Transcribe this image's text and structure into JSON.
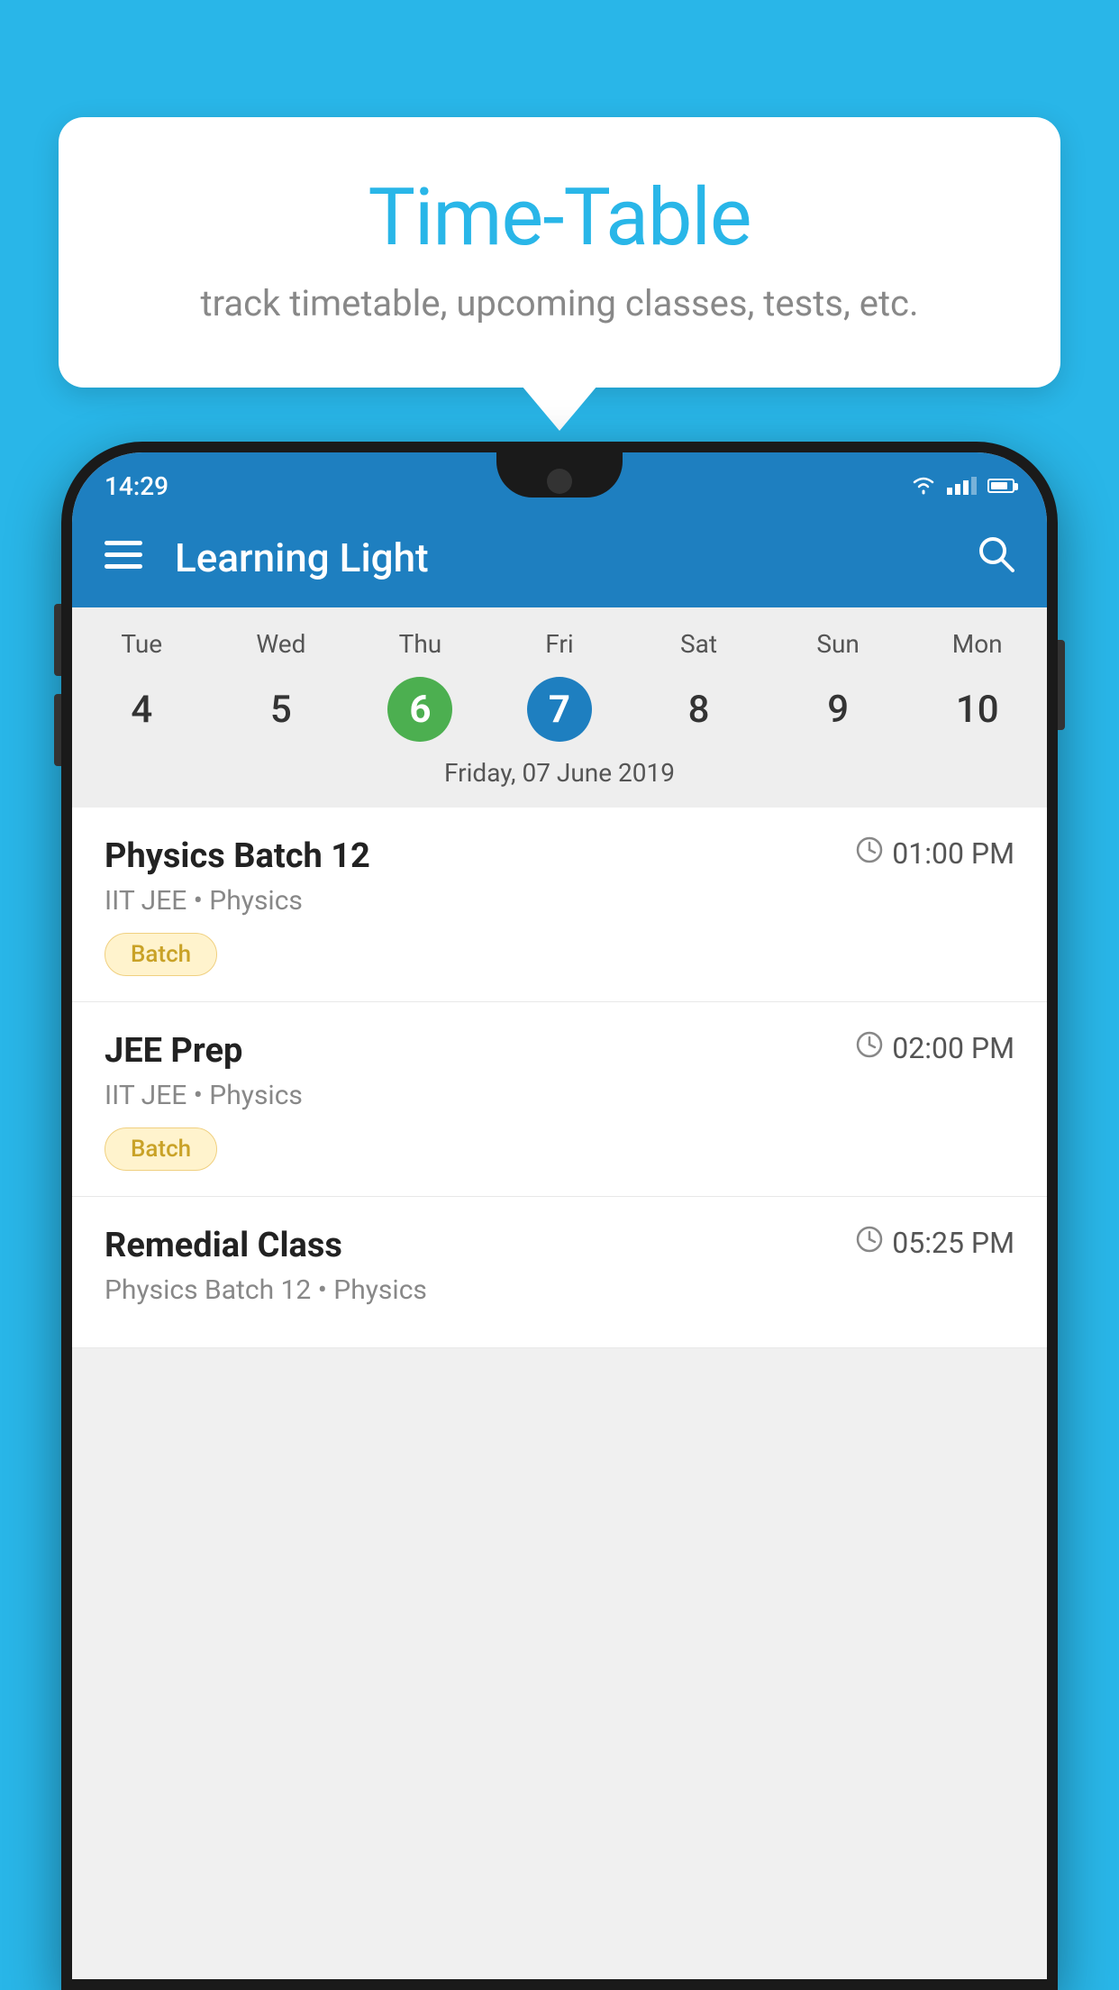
{
  "tooltip": {
    "title": "Time-Table",
    "subtitle": "track timetable, upcoming classes, tests, etc."
  },
  "status_bar": {
    "time": "14:29"
  },
  "app_bar": {
    "title": "Learning Light"
  },
  "calendar": {
    "days": [
      {
        "label": "Tue",
        "number": "4"
      },
      {
        "label": "Wed",
        "number": "5"
      },
      {
        "label": "Thu",
        "number": "6",
        "state": "today"
      },
      {
        "label": "Fri",
        "number": "7",
        "state": "selected"
      },
      {
        "label": "Sat",
        "number": "8"
      },
      {
        "label": "Sun",
        "number": "9"
      },
      {
        "label": "Mon",
        "number": "10"
      }
    ],
    "selected_date": "Friday, 07 June 2019"
  },
  "schedule": [
    {
      "name": "Physics Batch 12",
      "time": "01:00 PM",
      "meta": "IIT JEE • Physics",
      "badge": "Batch"
    },
    {
      "name": "JEE Prep",
      "time": "02:00 PM",
      "meta": "IIT JEE • Physics",
      "badge": "Batch"
    },
    {
      "name": "Remedial Class",
      "time": "05:25 PM",
      "meta": "Physics Batch 12 • Physics",
      "badge": null
    }
  ]
}
